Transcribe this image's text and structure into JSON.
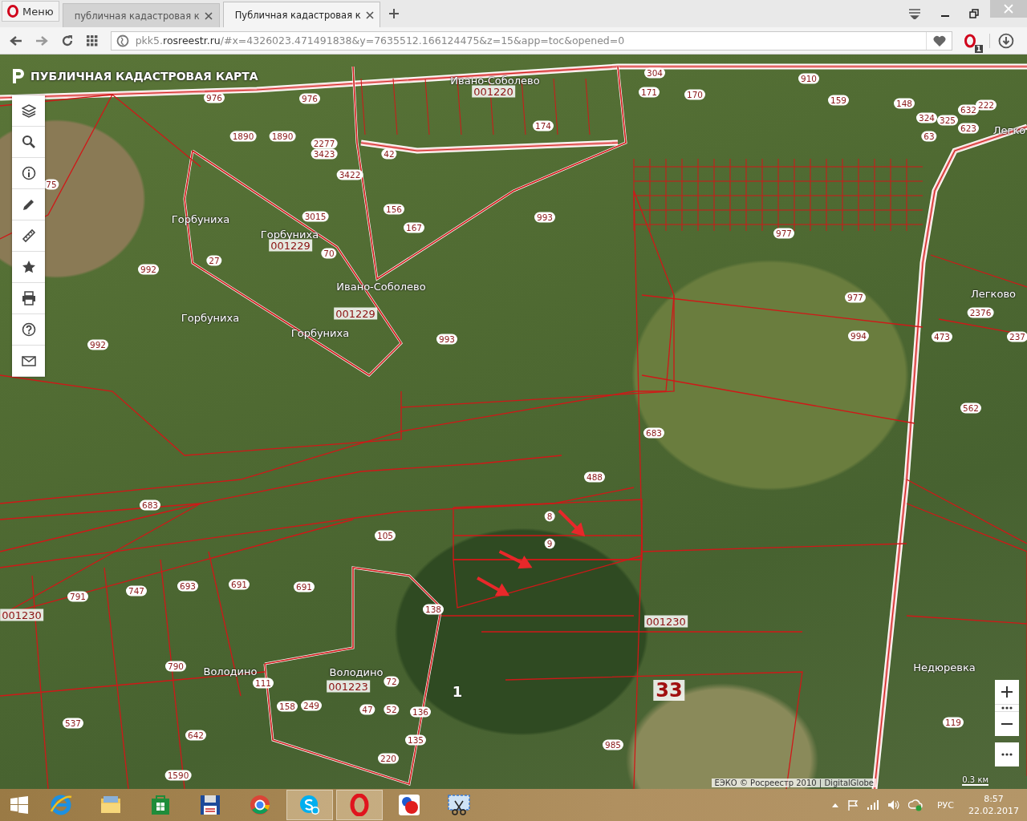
{
  "browser": {
    "menu_label": "Меню",
    "tabs": [
      {
        "title": "публичная кадастровая к",
        "selected": false
      },
      {
        "title": "Публичная кадастровая к",
        "selected": true
      }
    ],
    "address": {
      "host_prefix": "pkk5.",
      "host": "rosreestr.ru",
      "path": "/#x=4326023.471491838&y=7635512.166124475&z=15&app=toc&opened=0"
    },
    "extension_badge": "1"
  },
  "map": {
    "title": "ПУБЛИЧНАЯ КАДАСТРОВАЯ КАРТА",
    "labels": [
      {
        "text": "976",
        "kind": "parcel"
      },
      {
        "text": "976",
        "kind": "parcel"
      },
      {
        "text": "1890",
        "kind": "parcel"
      },
      {
        "text": "1890",
        "kind": "parcel"
      },
      {
        "text": "2277",
        "kind": "parcel"
      },
      {
        "text": "3423",
        "kind": "parcel"
      },
      {
        "text": "3422",
        "kind": "parcel"
      },
      {
        "text": "42",
        "kind": "parcel"
      },
      {
        "text": "156",
        "kind": "parcel"
      },
      {
        "text": "167",
        "kind": "parcel"
      },
      {
        "text": "3015",
        "kind": "parcel"
      },
      {
        "text": "70",
        "kind": "parcel"
      },
      {
        "text": "Горбуниха",
        "kind": "place"
      },
      {
        "text": "27",
        "kind": "parcel"
      },
      {
        "text": "Горбуниха",
        "kind": "place"
      },
      {
        "text": "001229",
        "kind": "quarter"
      },
      {
        "text": "Ивано-Соболево",
        "kind": "place"
      },
      {
        "text": "001229",
        "kind": "quarter"
      },
      {
        "text": "Горбуниха",
        "kind": "place"
      },
      {
        "text": "Горбуниха",
        "kind": "place"
      },
      {
        "text": "992",
        "kind": "parcel"
      },
      {
        "text": "992",
        "kind": "parcel"
      },
      {
        "text": "75",
        "kind": "parcel"
      },
      {
        "text": "Ивано-Соболево",
        "kind": "place"
      },
      {
        "text": "001220",
        "kind": "quarter"
      },
      {
        "text": "993",
        "kind": "parcel"
      },
      {
        "text": "993",
        "kind": "parcel"
      },
      {
        "text": "304",
        "kind": "parcel"
      },
      {
        "text": "910",
        "kind": "parcel"
      },
      {
        "text": "171",
        "kind": "parcel"
      },
      {
        "text": "170",
        "kind": "parcel"
      },
      {
        "text": "174",
        "kind": "parcel"
      },
      {
        "text": "159",
        "kind": "parcel"
      },
      {
        "text": "148",
        "kind": "parcel"
      },
      {
        "text": "324",
        "kind": "parcel"
      },
      {
        "text": "325",
        "kind": "parcel"
      },
      {
        "text": "632",
        "kind": "parcel"
      },
      {
        "text": "222",
        "kind": "parcel"
      },
      {
        "text": "623",
        "kind": "parcel"
      },
      {
        "text": "63",
        "kind": "parcel"
      },
      {
        "text": "Легко",
        "kind": "place"
      },
      {
        "text": "977",
        "kind": "parcel"
      },
      {
        "text": "977",
        "kind": "parcel"
      },
      {
        "text": "994",
        "kind": "parcel"
      },
      {
        "text": "Легково",
        "kind": "place"
      },
      {
        "text": "473",
        "kind": "parcel"
      },
      {
        "text": "2376",
        "kind": "parcel"
      },
      {
        "text": "237",
        "kind": "parcel"
      },
      {
        "text": "562",
        "kind": "parcel"
      },
      {
        "text": "683",
        "kind": "parcel"
      },
      {
        "text": "488",
        "kind": "parcel"
      },
      {
        "text": "8",
        "kind": "parcel"
      },
      {
        "text": "9",
        "kind": "parcel"
      },
      {
        "text": "683",
        "kind": "parcel"
      },
      {
        "text": "105",
        "kind": "parcel"
      },
      {
        "text": "747",
        "kind": "parcel"
      },
      {
        "text": "693",
        "kind": "parcel"
      },
      {
        "text": "691",
        "kind": "parcel"
      },
      {
        "text": "691",
        "kind": "parcel"
      },
      {
        "text": "791",
        "kind": "parcel"
      },
      {
        "text": "001230",
        "kind": "quarter"
      },
      {
        "text": "001230",
        "kind": "quarter"
      },
      {
        "text": "138",
        "kind": "parcel"
      },
      {
        "text": "790",
        "kind": "parcel"
      },
      {
        "text": "Володино",
        "kind": "place"
      },
      {
        "text": "Володино",
        "kind": "place"
      },
      {
        "text": "001223",
        "kind": "quarter"
      },
      {
        "text": "111",
        "kind": "parcel"
      },
      {
        "text": "72",
        "kind": "parcel"
      },
      {
        "text": "1",
        "kind": "district"
      },
      {
        "text": "33",
        "kind": "region"
      },
      {
        "text": "Недюревка",
        "kind": "place"
      },
      {
        "text": "119",
        "kind": "parcel"
      },
      {
        "text": "985",
        "kind": "parcel"
      },
      {
        "text": "537",
        "kind": "parcel"
      },
      {
        "text": "642",
        "kind": "parcel"
      },
      {
        "text": "1590",
        "kind": "parcel"
      },
      {
        "text": "158",
        "kind": "parcel"
      },
      {
        "text": "249",
        "kind": "parcel"
      },
      {
        "text": "47",
        "kind": "parcel"
      },
      {
        "text": "52",
        "kind": "parcel"
      },
      {
        "text": "136",
        "kind": "parcel"
      },
      {
        "text": "135",
        "kind": "parcel"
      },
      {
        "text": "220",
        "kind": "parcel"
      }
    ],
    "attribution": "ЕЭКО © Росреестр 2010 | DigitalGlobe",
    "scale": "0.3 км"
  },
  "taskbar": {
    "apps": [
      {
        "kind": "explorer-e",
        "selected": false
      },
      {
        "kind": "folder",
        "selected": false
      },
      {
        "kind": "store",
        "selected": false
      },
      {
        "kind": "floppy",
        "selected": false
      },
      {
        "kind": "wheel",
        "selected": false
      },
      {
        "kind": "chat",
        "selected": true
      },
      {
        "kind": "ring",
        "selected": true
      },
      {
        "kind": "blob",
        "selected": false
      },
      {
        "kind": "scissors",
        "selected": false
      }
    ],
    "language": "РУС",
    "time": "8:57",
    "date": "22.02.2017"
  }
}
